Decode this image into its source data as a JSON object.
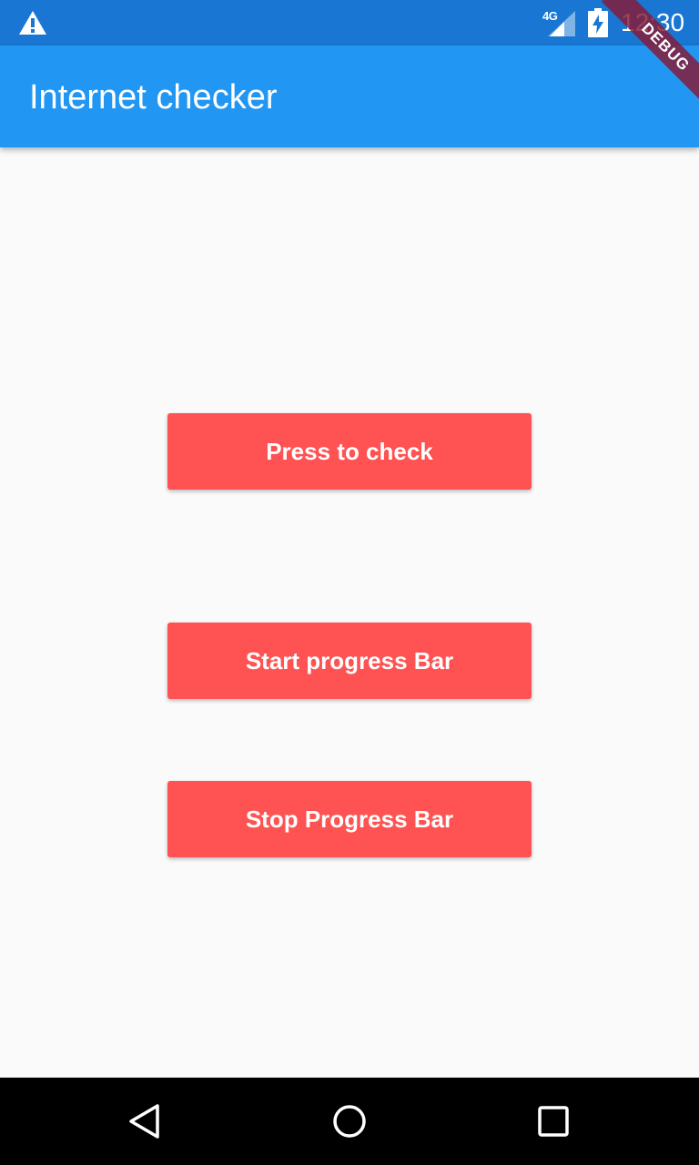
{
  "status_bar": {
    "network_type": "4G",
    "time": "12:30",
    "icons": [
      "warning-icon",
      "signal-icon",
      "battery-charging-icon"
    ]
  },
  "app_bar": {
    "title": "Internet checker"
  },
  "debug_banner": {
    "label": "DEBUG"
  },
  "buttons": {
    "check_label": "Press to check",
    "start_label": "Start progress Bar",
    "stop_label": "Stop Progress Bar"
  },
  "nav_bar": {
    "icons": [
      "back-icon",
      "home-icon",
      "recents-icon"
    ]
  },
  "colors": {
    "status_bar": "#1976d2",
    "app_bar": "#2196f3",
    "button": "#ff5252",
    "background": "#fafafa",
    "nav_bar": "#000000",
    "debug_banner": "#881834"
  }
}
